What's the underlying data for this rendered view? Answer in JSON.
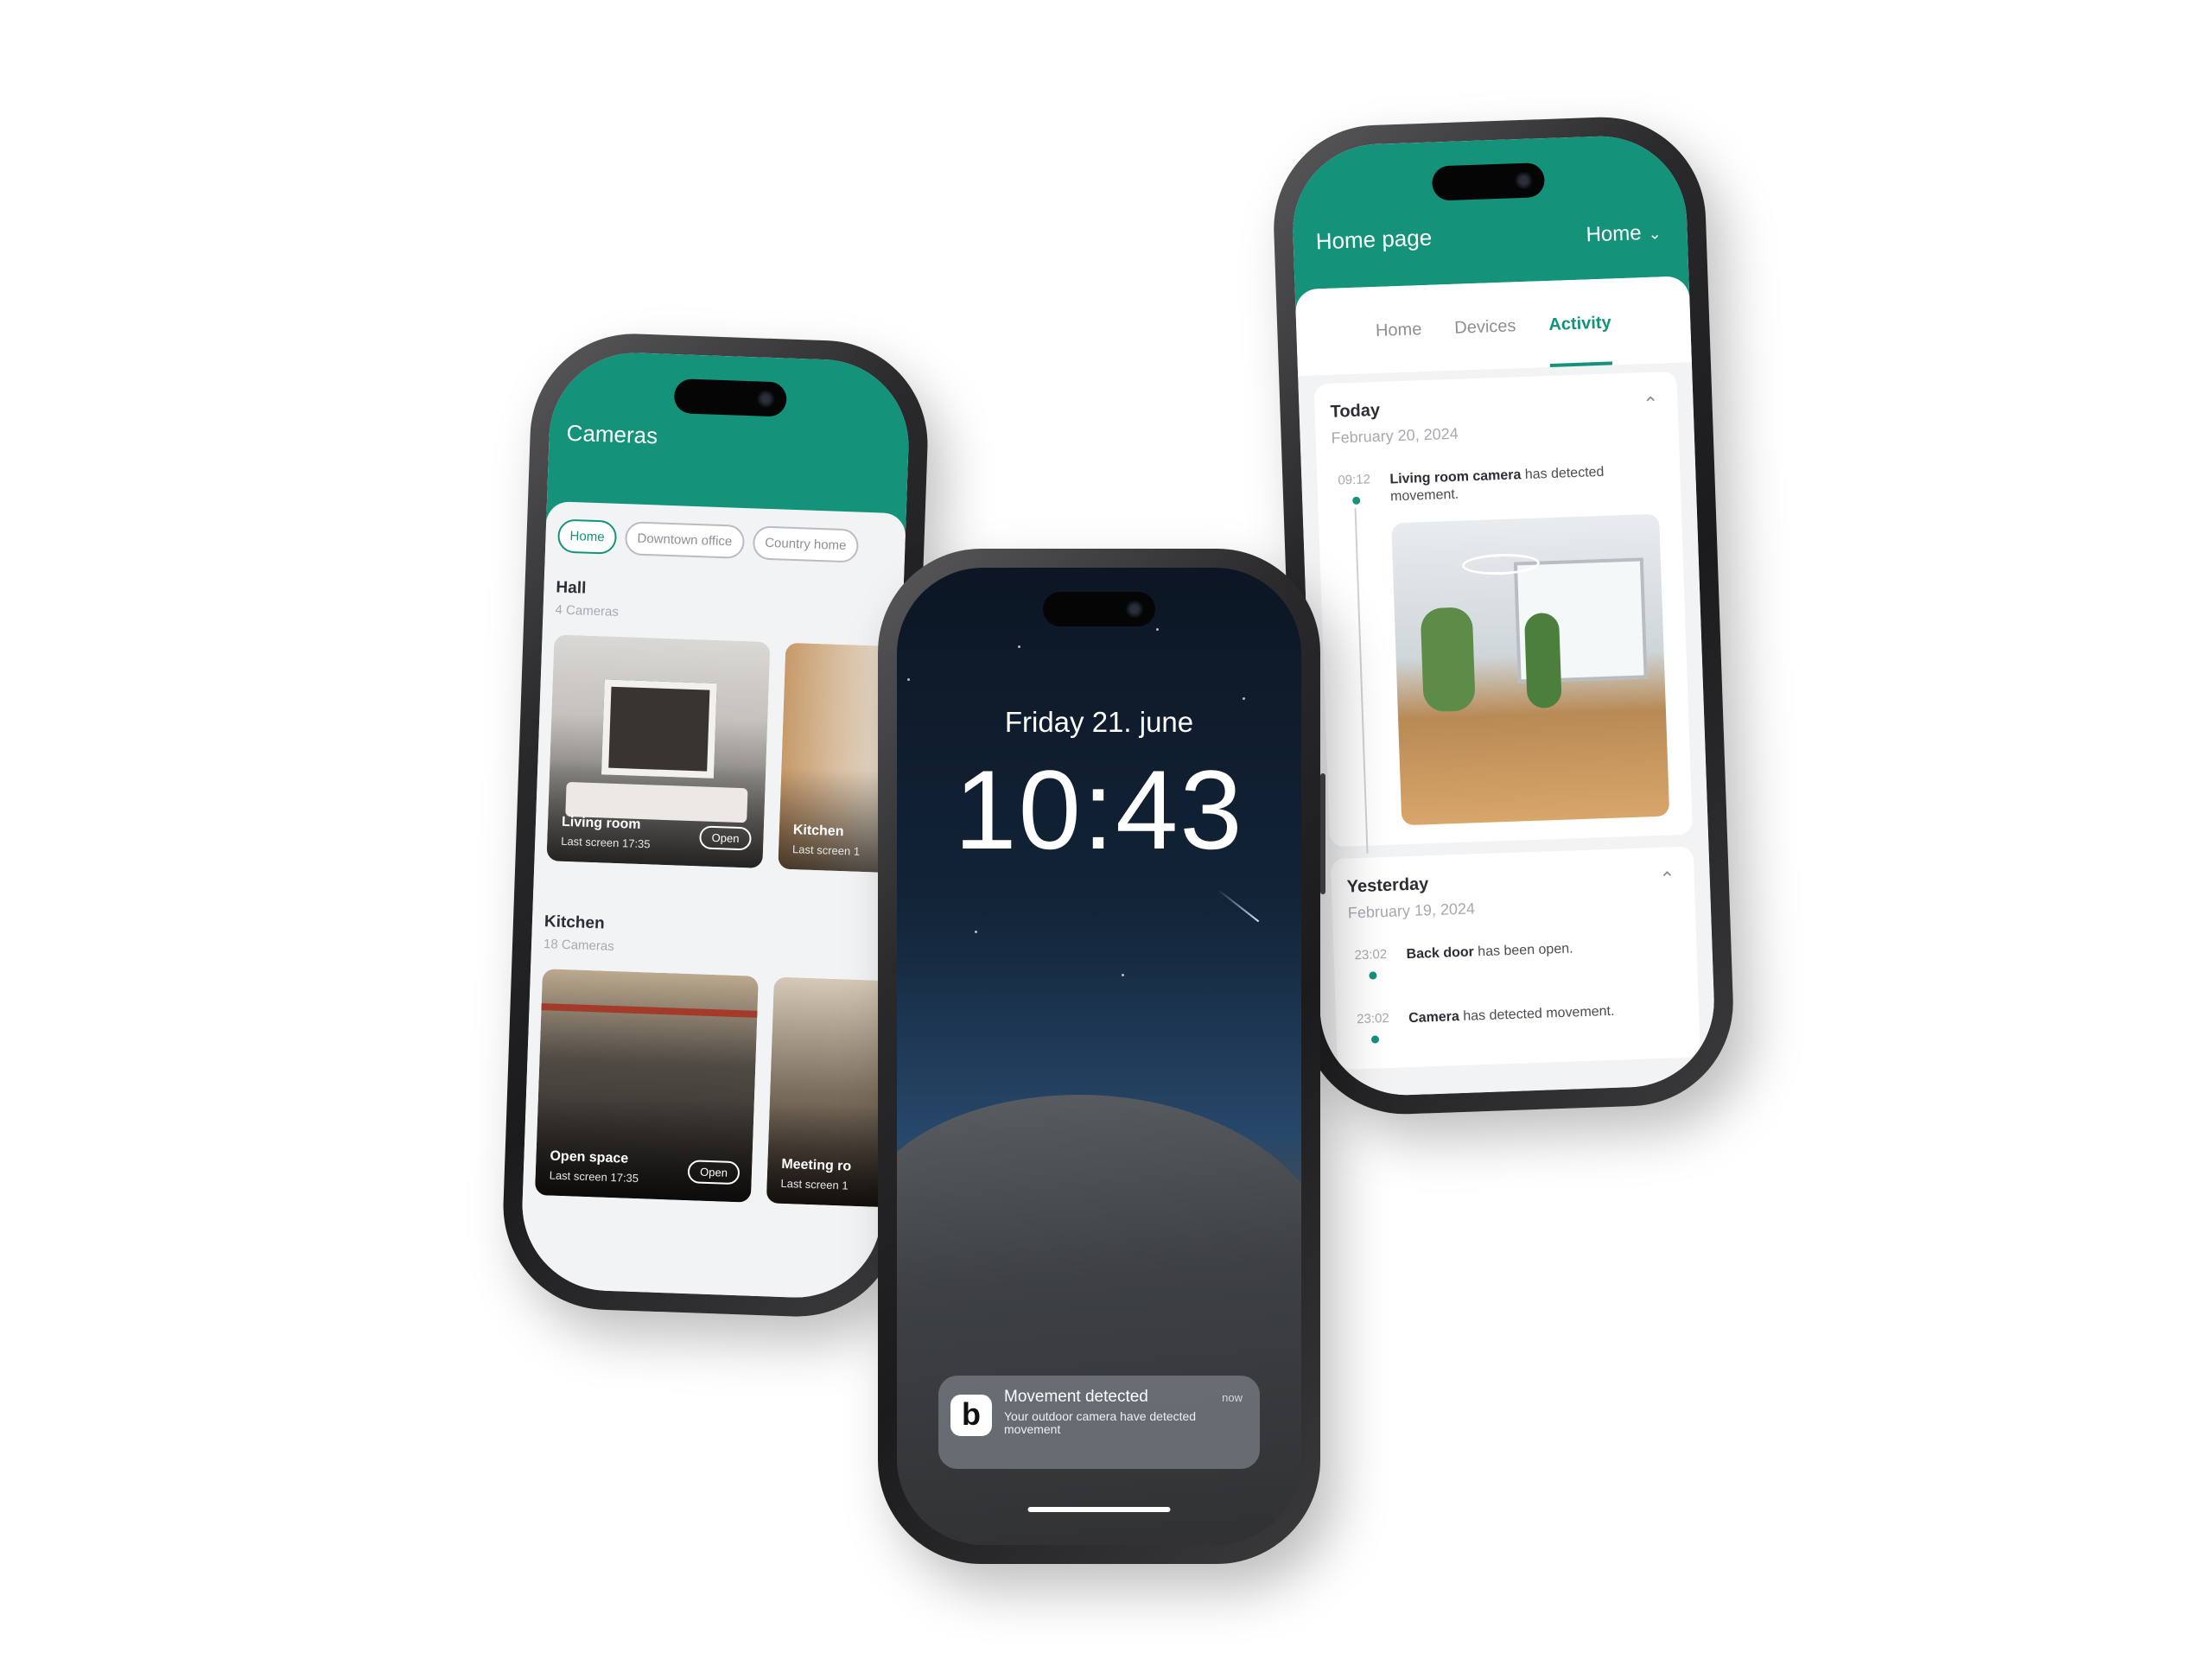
{
  "left_phone": {
    "title": "Cameras",
    "chips": [
      {
        "label": "Home",
        "active": true
      },
      {
        "label": "Downtown office",
        "active": false
      },
      {
        "label": "Country home",
        "active": false
      }
    ],
    "sections": [
      {
        "title": "Hall",
        "subtitle": "4 Cameras",
        "cards": [
          {
            "name": "Living room",
            "time": "Last screen 17:35",
            "open_label": "Open"
          },
          {
            "name": "Kitchen",
            "time": "Last screen 1"
          }
        ]
      },
      {
        "title": "Kitchen",
        "subtitle": "18 Cameras",
        "cards": [
          {
            "name": "Open space",
            "time": "Last screen 17:35",
            "open_label": "Open"
          },
          {
            "name": "Meeting ro",
            "time": "Last screen 1"
          }
        ]
      }
    ]
  },
  "center_phone": {
    "date": "Friday 21. june",
    "time": "10:43",
    "notification": {
      "app_icon_letter": "b",
      "title": "Movement detected",
      "body": "Your outdoor camera have detected movement",
      "time": "now"
    }
  },
  "right_phone": {
    "title": "Home page",
    "home_select": "Home",
    "tabs": [
      {
        "label": "Home",
        "active": false
      },
      {
        "label": "Devices",
        "active": false
      },
      {
        "label": "Activity",
        "active": true
      }
    ],
    "days": [
      {
        "title": "Today",
        "date": "February 20, 2024",
        "events": [
          {
            "time": "09:12",
            "bold": "Living room camera",
            "text": " has detected movement."
          }
        ]
      },
      {
        "title": "Yesterday",
        "date": "February 19, 2024",
        "events": [
          {
            "time": "23:02",
            "bold": "Back door",
            "text": " has been open."
          },
          {
            "time": "23:02",
            "bold": "Camera",
            "text": " has detected movement."
          }
        ]
      }
    ]
  },
  "colors": {
    "brand": "#14927a",
    "background": "#ffffff",
    "panel": "#f2f3f5"
  }
}
